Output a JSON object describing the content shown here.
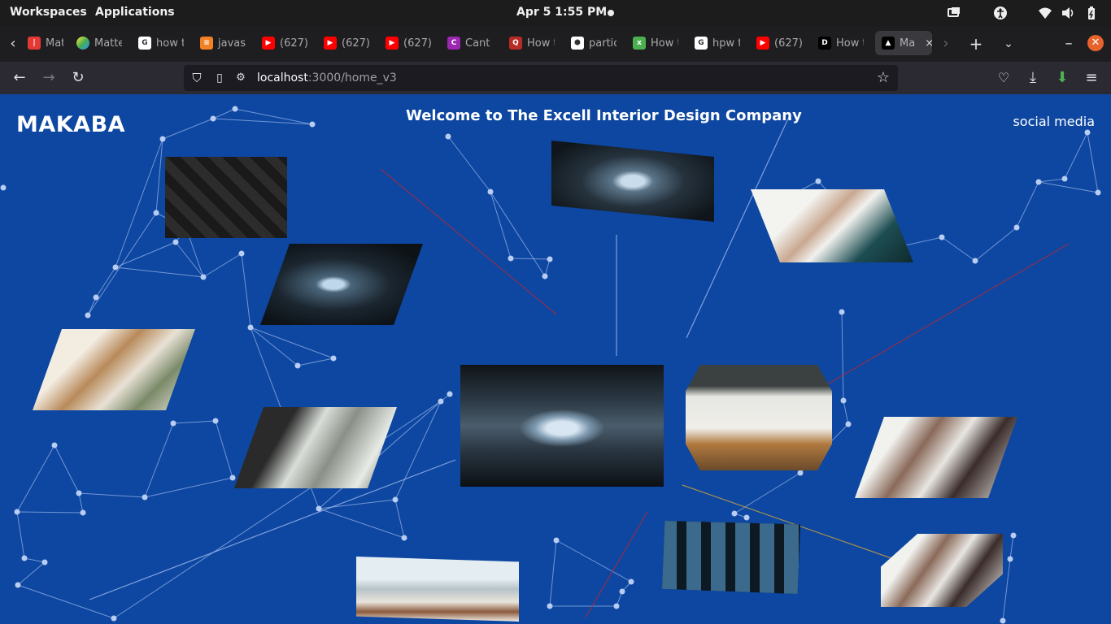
{
  "system_bar": {
    "workspaces": "Workspaces",
    "applications": "Applications",
    "datetime": "Apr 5   1:55 PM"
  },
  "tabs": [
    {
      "label": "Matte",
      "favicon": "ff-red-icon",
      "color": "#e53935"
    },
    {
      "label": "Matte",
      "favicon": "gradient-circle-icon",
      "color": "#4caf50"
    },
    {
      "label": "how t",
      "favicon": "google-icon",
      "color": "#ffffff"
    },
    {
      "label": "javas",
      "favicon": "stackoverflow-icon",
      "color": "#f48024"
    },
    {
      "label": "(627)",
      "favicon": "youtube-icon",
      "color": "#ff0000"
    },
    {
      "label": "(627)",
      "favicon": "youtube-icon",
      "color": "#ff0000"
    },
    {
      "label": "(627)",
      "favicon": "youtube-icon",
      "color": "#ff0000"
    },
    {
      "label": "Cant",
      "favicon": "colorful-c-icon",
      "color": "#9c27b0"
    },
    {
      "label": "How t",
      "favicon": "quora-icon",
      "color": "#b92b27"
    },
    {
      "label": "partic",
      "favicon": "hex-icon",
      "color": "#ffffff"
    },
    {
      "label": "How t",
      "favicon": "exi-icon",
      "color": "#4caf50"
    },
    {
      "label": "hpw t",
      "favicon": "google-icon",
      "color": "#ffffff"
    },
    {
      "label": "(627)",
      "favicon": "youtube-icon",
      "color": "#ff0000"
    },
    {
      "label": "How t",
      "favicon": "dev-icon",
      "color": "#000000"
    },
    {
      "label": "Ma",
      "favicon": "nextjs-icon",
      "color": "#000000",
      "active": true
    }
  ],
  "address_bar": {
    "host": "localhost",
    "path": ":3000/home_v3"
  },
  "page": {
    "brand": "MAKABA",
    "welcome": "Welcome to The Excell Interior Design Company",
    "social": "social media"
  },
  "colors": {
    "background": "#0d47a1",
    "network_line": "#9fb8ec",
    "accent_red": "#b0283a",
    "accent_gold": "#c9a23a"
  }
}
